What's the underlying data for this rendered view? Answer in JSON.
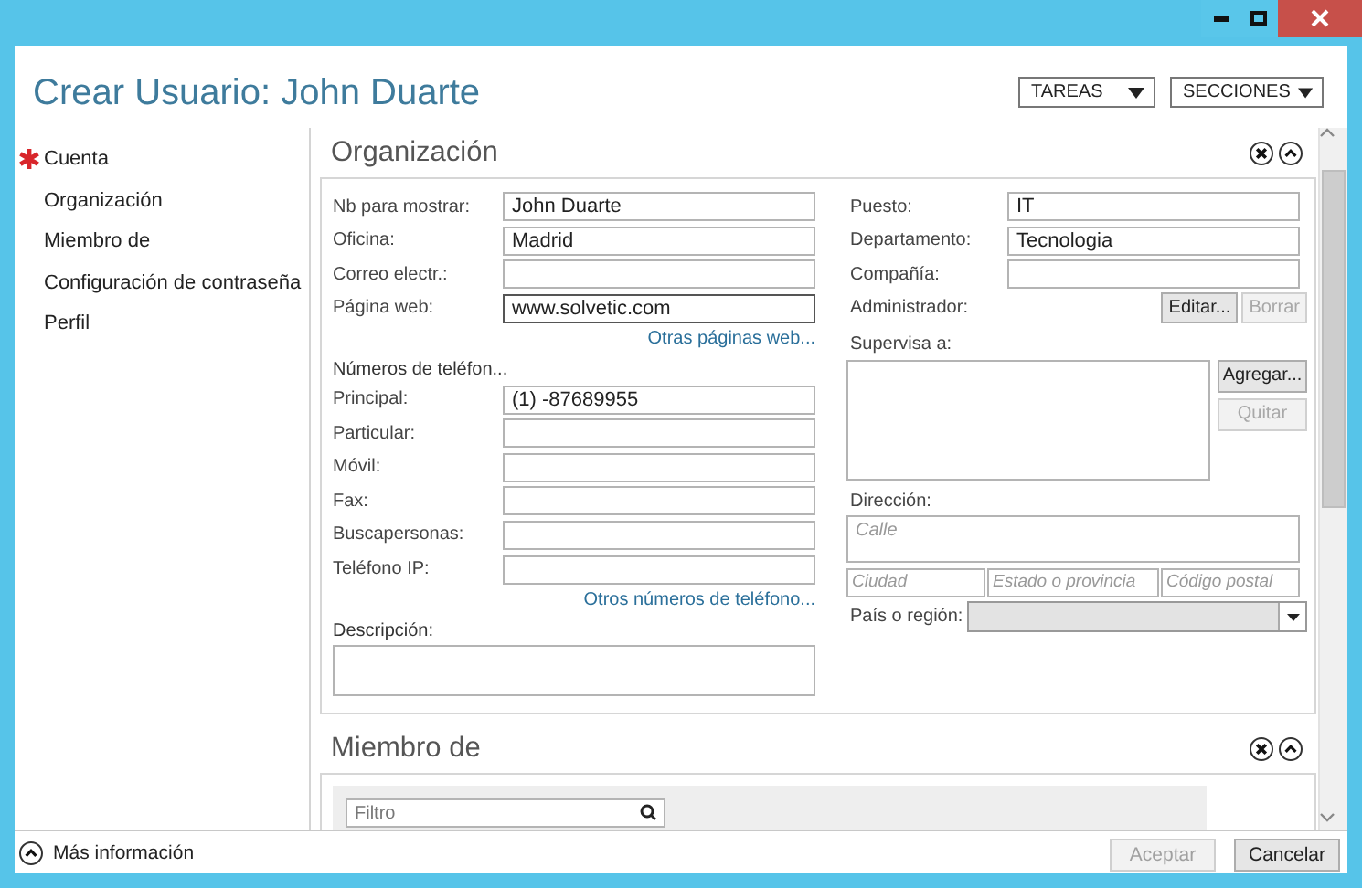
{
  "window": {
    "title": "Crear Usuario: John Duarte"
  },
  "header_menus": [
    {
      "label": "TAREAS"
    },
    {
      "label": "SECCIONES"
    }
  ],
  "nav": {
    "items": [
      {
        "label": "Cuenta",
        "required": true
      },
      {
        "label": "Organización",
        "required": false
      },
      {
        "label": "Miembro de",
        "required": false
      },
      {
        "label": "Configuración de contraseña",
        "required": false
      },
      {
        "label": "Perfil",
        "required": false
      }
    ]
  },
  "organization": {
    "title": "Organización",
    "left_fields": [
      {
        "label": "Nb para mostrar:",
        "value": "John Duarte",
        "focused": false
      },
      {
        "label": "Oficina:",
        "value": "Madrid",
        "focused": false
      },
      {
        "label": "Correo electr.:",
        "focused": false
      },
      {
        "label": "Página web:",
        "value": "www.solvetic.com",
        "focused": true
      }
    ],
    "web_link": "Otras páginas web...",
    "phones_heading": "Números de teléfon...",
    "phones": [
      {
        "label": "Principal:",
        "value": "(1) -87689955"
      },
      {
        "label": "Particular:"
      },
      {
        "label": "Móvil:"
      },
      {
        "label": "Fax:"
      },
      {
        "label": "Buscapersonas:"
      },
      {
        "label": "Teléfono IP:"
      }
    ],
    "phones_link": "Otros números de teléfono...",
    "description_label": "Descripción:",
    "right_fields": [
      {
        "label": "Puesto:",
        "value": "IT"
      },
      {
        "label": "Departamento:",
        "value": "Tecnologia"
      },
      {
        "label": "Compañía:"
      }
    ],
    "manager": {
      "label": "Administrador:",
      "buttons": [
        {
          "label": "Editar...",
          "disabled": false
        },
        {
          "label": "Borrar",
          "disabled": true
        }
      ]
    },
    "reports": {
      "label": "Supervisa a:",
      "buttons": [
        {
          "label": "Agregar...",
          "disabled": false
        },
        {
          "label": "Quitar",
          "disabled": true
        }
      ]
    },
    "address": {
      "label": "Dirección:",
      "street_placeholder": "Calle",
      "city_placeholder": "Ciudad",
      "state_placeholder": "Estado o provincia",
      "zip_placeholder": "Código postal"
    },
    "country": {
      "label": "País o región:",
      "disabled": true
    }
  },
  "member": {
    "title": "Miembro de",
    "filter_placeholder": "Filtro"
  },
  "footer": {
    "more_info": "Más información",
    "buttons": [
      {
        "label": "Aceptar",
        "disabled": true
      },
      {
        "label": "Cancelar",
        "disabled": false
      }
    ]
  }
}
